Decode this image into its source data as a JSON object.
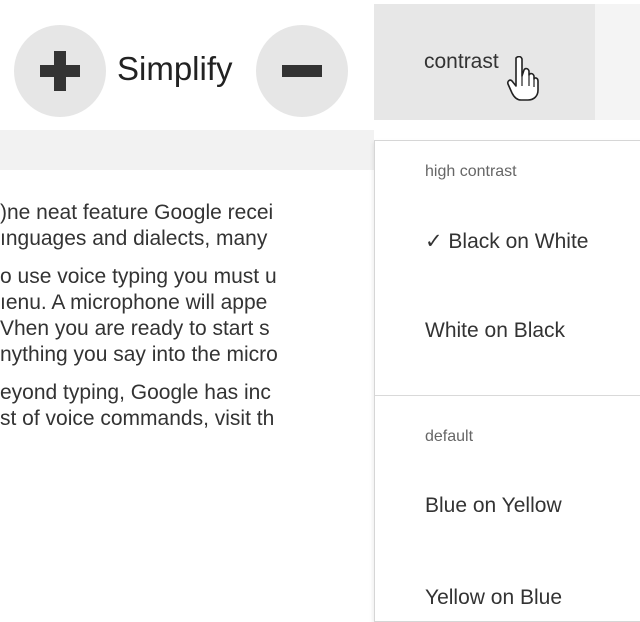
{
  "toolbar": {
    "zoom_in_icon": "plus-icon",
    "simplify_label": "Simplify",
    "zoom_out_icon": "minus-icon",
    "contrast_label": "contrast"
  },
  "document": {
    "paragraphs": [
      {
        "lines": [
          ")ne neat feature Google recei",
          "ınguages and dialects, many"
        ]
      },
      {
        "lines": [
          "o use voice typing you must u",
          "ıenu.  A microphone will appe",
          "Vhen you are ready to start s",
          "nything you say into the micro"
        ]
      },
      {
        "lines": [
          "eyond typing, Google has inc",
          "st of voice commands, visit th"
        ]
      }
    ]
  },
  "contrast_menu": {
    "high_contrast_header": "high contrast",
    "high_contrast_items": [
      {
        "label": "✓ Black on White",
        "selected": true
      },
      {
        "label": "White on Black",
        "selected": false
      }
    ],
    "default_header": "default",
    "default_items": [
      {
        "label": "Blue on Yellow"
      },
      {
        "label": "Yellow on Blue"
      }
    ]
  },
  "colors": {
    "button_gray": "#e6e6e6",
    "tab_gray": "#e7e7e7",
    "text": "#333333"
  }
}
